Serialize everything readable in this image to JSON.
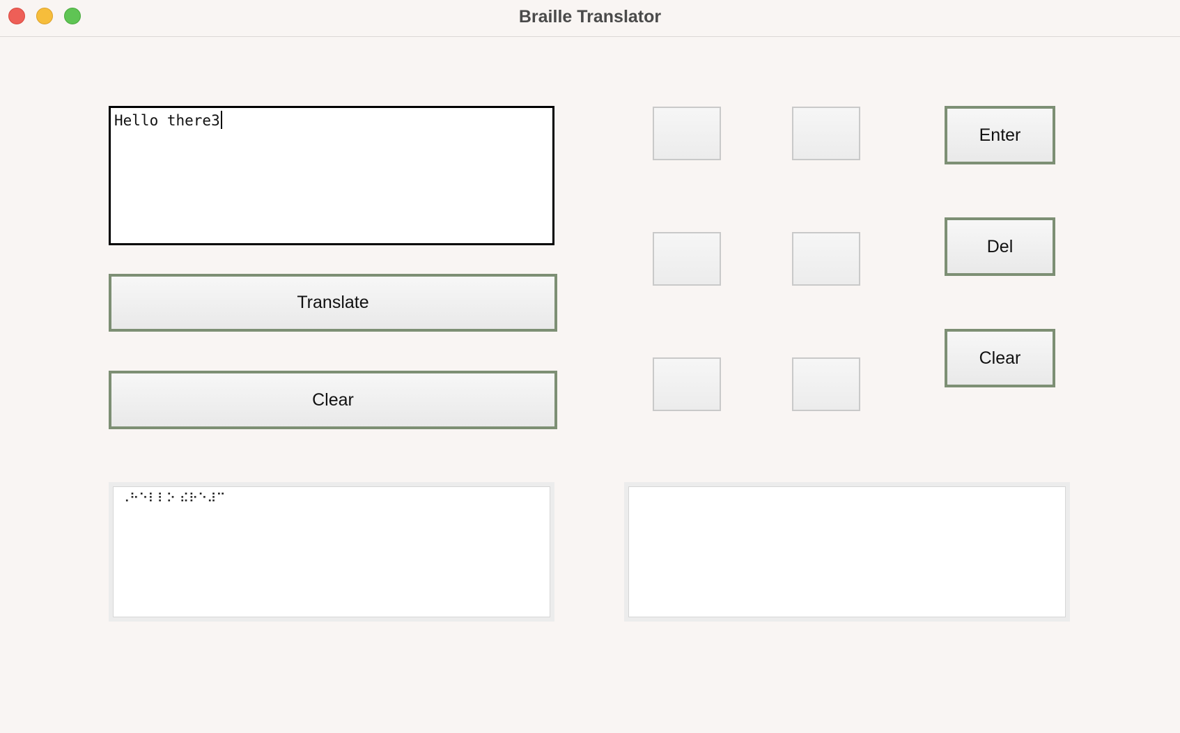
{
  "window": {
    "title": "Braille Translator"
  },
  "input": {
    "value": "Hello there3"
  },
  "buttons": {
    "translate": "Translate",
    "clear_main": "Clear",
    "enter": "Enter",
    "delete": "Del",
    "clear_side": "Clear"
  },
  "braille_output": {
    "value": "⠠⠓⠑⠇⠇⠕ ⠮⠗⠑⠼⠉"
  },
  "braille_entry": {
    "value": ""
  },
  "colors": {
    "button_border": "#7d8f74",
    "background": "#f9f5f3"
  }
}
